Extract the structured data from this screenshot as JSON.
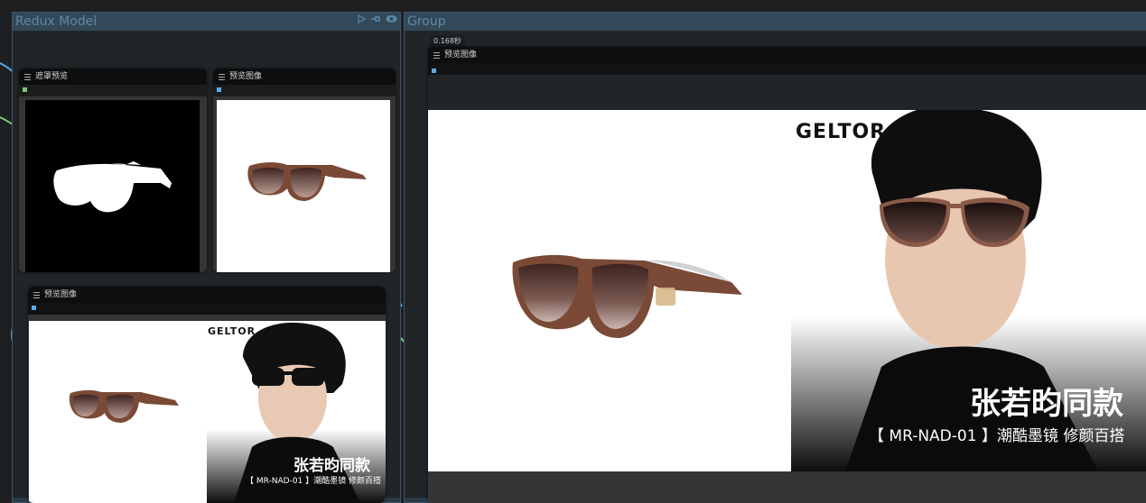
{
  "groups": {
    "left": {
      "title": "Redux Model"
    },
    "right": {
      "title": "Group"
    }
  },
  "nodes": {
    "mask_preview": {
      "title": "遮罩预览"
    },
    "preview_top": {
      "title": "预览图像"
    },
    "preview_bottom": {
      "title": "预览图像"
    },
    "preview_large": {
      "title": "预览图像",
      "time_badge": "0.168秒"
    }
  },
  "ad": {
    "brand": "GELTOR",
    "headline": "张若昀同款",
    "subline": "【 MR-NAD-01 】潮酷墨镜 修颜百搭"
  },
  "icons": [
    "play-icon",
    "pin-icon",
    "eye-icon",
    "hamburger-icon"
  ],
  "colors": {
    "group_header": "#33495a",
    "group_title": "#5e87a5",
    "node_header": "#0d0e10",
    "canvas": "#1e1f21",
    "sunglass_frame": "#7a4a36",
    "sunglass_lens": "#3e2320",
    "link_green": "#7dc874",
    "link_blue": "#5aa9e6"
  }
}
